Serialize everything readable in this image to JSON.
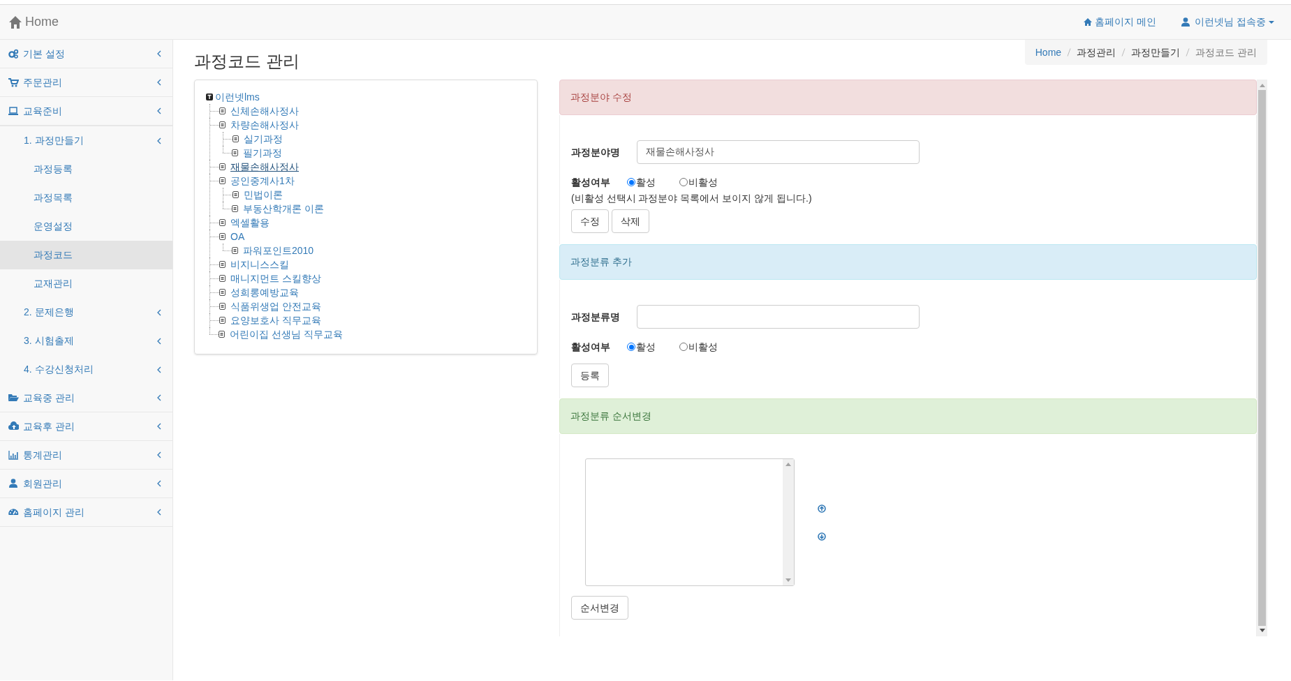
{
  "navbar": {
    "brand": "Home",
    "links": [
      {
        "text": "홈페이지 메인",
        "dropdown": false
      },
      {
        "text": "이런넷님 접속중",
        "dropdown": true
      }
    ]
  },
  "sidebar": {
    "items": [
      {
        "label": "기본 설정",
        "expandable": true,
        "selected": false
      },
      {
        "label": "주문관리",
        "expandable": true,
        "selected": false
      },
      {
        "label": "교육준비",
        "expandable": true,
        "selected": false,
        "children": [
          {
            "label": "1. 과정만들기",
            "expandable": true,
            "selected": false,
            "children": [
              {
                "label": "과정등록",
                "expandable": false,
                "selected": false
              },
              {
                "label": "과정목록",
                "expandable": false,
                "selected": false
              },
              {
                "label": "운영설정",
                "expandable": false,
                "selected": false
              },
              {
                "label": "과정코드",
                "expandable": false,
                "selected": true
              },
              {
                "label": "교재관리",
                "expandable": false,
                "selected": false
              }
            ]
          },
          {
            "label": "2. 문제은행",
            "expandable": true,
            "selected": false
          },
          {
            "label": "3. 시험출제",
            "expandable": true,
            "selected": false
          },
          {
            "label": "4. 수강신청처리",
            "expandable": true,
            "selected": false
          }
        ]
      },
      {
        "label": "교육중 관리",
        "expandable": true,
        "selected": false
      },
      {
        "label": "교육후 관리",
        "expandable": true,
        "selected": false
      },
      {
        "label": "통계관리",
        "expandable": true,
        "selected": false
      },
      {
        "label": "회원관리",
        "expandable": true,
        "selected": false
      },
      {
        "label": "홈페이지 관리",
        "expandable": true,
        "selected": false
      }
    ]
  },
  "page_title": "과정코드 관리",
  "breadcrumb": [
    {
      "text": "Home",
      "kind": "link"
    },
    {
      "text": "과정관리",
      "kind": "plain"
    },
    {
      "text": "과정만들기",
      "kind": "plain"
    },
    {
      "text": "과정코드 관리",
      "kind": "active"
    }
  ],
  "tree": {
    "label": "이런넷lms",
    "selected": false,
    "children": [
      {
        "label": "신체손해사정사",
        "selected": false
      },
      {
        "label": "차량손해사정사",
        "selected": false,
        "children": [
          {
            "label": "실기과정",
            "selected": false
          },
          {
            "label": "필기과정",
            "selected": false
          }
        ]
      },
      {
        "label": "재물손해사정사",
        "selected": true
      },
      {
        "label": "공인중계사1차",
        "selected": false,
        "children": [
          {
            "label": "민법이론",
            "selected": false
          },
          {
            "label": "부동산학개론 이론",
            "selected": false
          }
        ]
      },
      {
        "label": "엑셀활용",
        "selected": false
      },
      {
        "label": "OA",
        "selected": false,
        "children": [
          {
            "label": "파워포인트2010",
            "selected": false
          }
        ]
      },
      {
        "label": "비지니스스킬",
        "selected": false
      },
      {
        "label": "매니지먼트 스킬향상",
        "selected": false
      },
      {
        "label": "성희롱예방교육",
        "selected": false
      },
      {
        "label": "식품위생업 안전교육",
        "selected": false
      },
      {
        "label": "요양보호사 직무교육",
        "selected": false
      },
      {
        "label": "어린이집 선생님 직무교육",
        "selected": false
      }
    ]
  },
  "edit_panel": {
    "title": "과정분야 수정",
    "name_label": "과정분야명",
    "name_value": "재물손해사정사",
    "active_label": "활성여부",
    "options": [
      {
        "label": "활성",
        "selected": true
      },
      {
        "label": "비활성",
        "selected": false
      }
    ],
    "note": "(비활성 선택시 과정분야 목록에서 보이지 않게 됩니다.)",
    "buttons": [
      "수정",
      "삭제"
    ]
  },
  "add_panel": {
    "title": "과정분류 추가",
    "name_label": "과정분류명",
    "active_label": "활성여부",
    "options": [
      {
        "label": "활성",
        "selected": true
      },
      {
        "label": "비활성",
        "selected": false
      }
    ],
    "buttons": [
      "등록"
    ]
  },
  "order_panel": {
    "title": "과정분류 순서변경",
    "buttons": [
      "순서변경"
    ]
  }
}
